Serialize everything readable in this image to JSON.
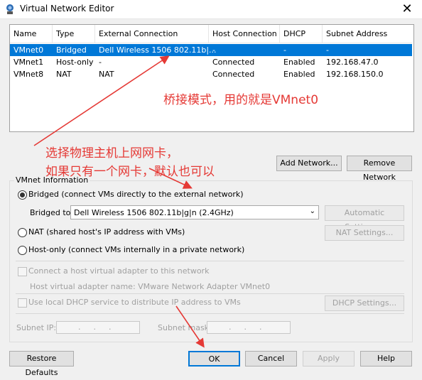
{
  "window": {
    "title": "Virtual Network Editor",
    "close_glyph": "✕"
  },
  "table": {
    "headers": [
      "Name",
      "Type",
      "External Connection",
      "Host Connection",
      "DHCP",
      "Subnet Address"
    ],
    "rows": [
      [
        "VMnet0",
        "Bridged",
        "Dell Wireless 1506 802.11b|...",
        "-",
        "-",
        "-"
      ],
      [
        "VMnet1",
        "Host-only",
        "-",
        "Connected",
        "Enabled",
        "192.168.47.0"
      ],
      [
        "VMnet8",
        "NAT",
        "NAT",
        "Connected",
        "Enabled",
        "192.168.150.0"
      ]
    ]
  },
  "buttons": {
    "add_network": "Add Network...",
    "remove_network": "Remove Network",
    "automatic_settings": "Automatic Settings...",
    "nat_settings": "NAT Settings...",
    "dhcp_settings": "DHCP Settings...",
    "restore_defaults": "Restore Defaults",
    "ok": "OK",
    "cancel": "Cancel",
    "apply": "Apply",
    "help": "Help"
  },
  "vmnet_info": {
    "label": "VMnet Information",
    "bridged_label": "Bridged (connect VMs directly to the external network)",
    "bridged_to_label": "Bridged to:",
    "bridged_to_value": "Dell Wireless 1506 802.11b|g|n (2.4GHz)",
    "nat_label": "NAT (shared host's IP address with VMs)",
    "hostonly_label": "Host-only (connect VMs internally in a private network)",
    "connect_adapter_label": "Connect a host virtual adapter to this network",
    "adapter_name_label": "Host virtual adapter name: VMware Network Adapter VMnet0",
    "dhcp_label": "Use local DHCP service to distribute IP address to VMs",
    "subnet_ip_label": "Subnet IP:",
    "subnet_mask_label": "Subnet mask:",
    "ip_dots": "...",
    "selected_mode": "bridged"
  },
  "annotations": {
    "bridge_mode": "桥接模式，用的就是VMnet0",
    "select_nic_line1": "选择物理主机上网网卡，",
    "select_nic_line2": "如果只有一个网卡，默认也可以",
    "color": "#e53935"
  }
}
